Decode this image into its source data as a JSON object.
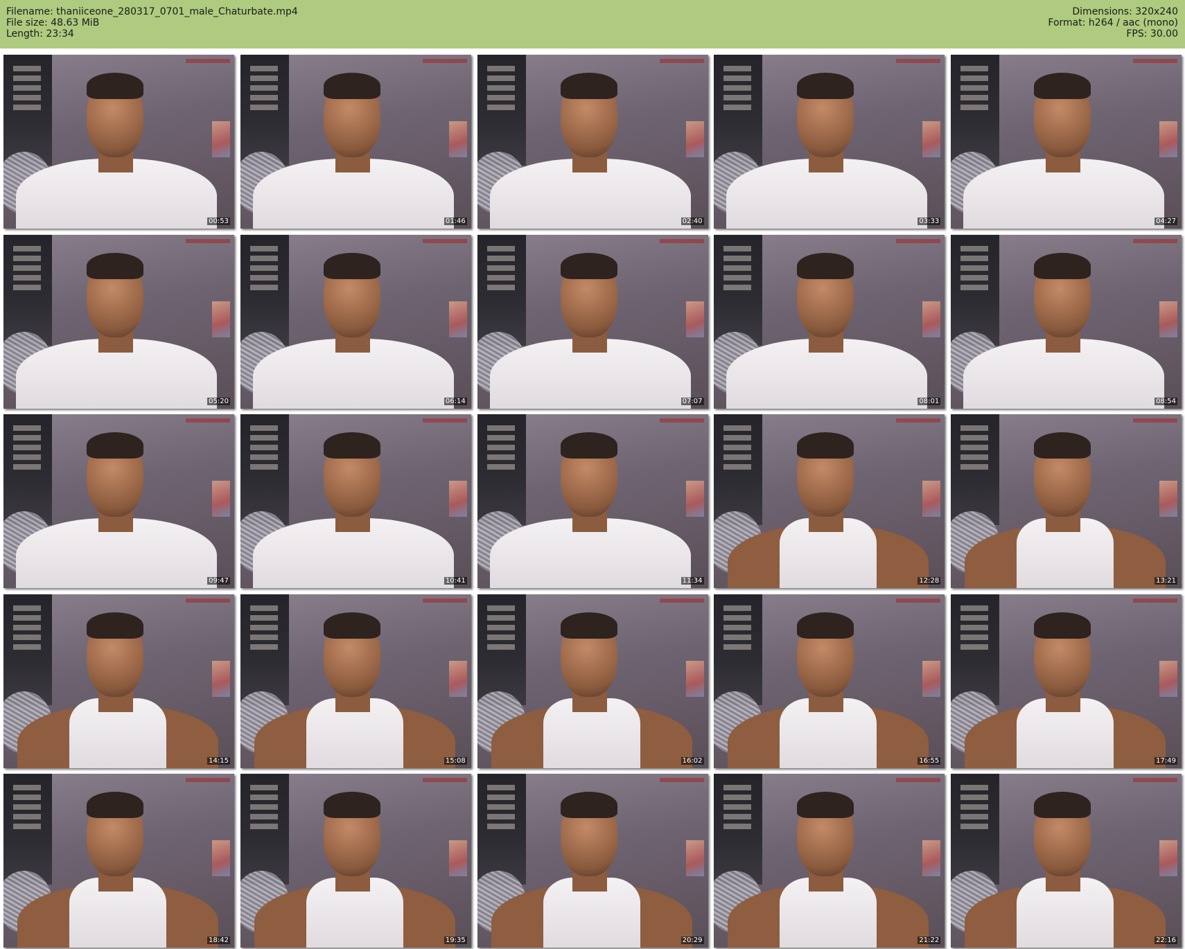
{
  "header": {
    "left": [
      "Filename: thaniiceone_280317_0701_male_Chaturbate.mp4",
      "File size: 48.63 MiB",
      "Length: 23:34"
    ],
    "right": [
      "Dimensions: 320x240",
      "Format: h264 / aac (mono)",
      "FPS: 30.00"
    ]
  },
  "thumbnails": [
    {
      "time": "00:53",
      "shirt": "tee"
    },
    {
      "time": "01:46",
      "shirt": "tee"
    },
    {
      "time": "02:40",
      "shirt": "tee"
    },
    {
      "time": "03:33",
      "shirt": "tee"
    },
    {
      "time": "04:27",
      "shirt": "tee"
    },
    {
      "time": "05:20",
      "shirt": "tee"
    },
    {
      "time": "06:14",
      "shirt": "tee"
    },
    {
      "time": "07:07",
      "shirt": "tee"
    },
    {
      "time": "08:01",
      "shirt": "tee"
    },
    {
      "time": "08:54",
      "shirt": "tee"
    },
    {
      "time": "09:47",
      "shirt": "tee"
    },
    {
      "time": "10:41",
      "shirt": "tee"
    },
    {
      "time": "11:34",
      "shirt": "tee"
    },
    {
      "time": "12:28",
      "shirt": "tank"
    },
    {
      "time": "13:21",
      "shirt": "tank"
    },
    {
      "time": "14:15",
      "shirt": "tank"
    },
    {
      "time": "15:08",
      "shirt": "tank"
    },
    {
      "time": "16:02",
      "shirt": "tank"
    },
    {
      "time": "16:55",
      "shirt": "tank"
    },
    {
      "time": "17:49",
      "shirt": "tank"
    },
    {
      "time": "18:42",
      "shirt": "tank"
    },
    {
      "time": "19:35",
      "shirt": "tank"
    },
    {
      "time": "20:29",
      "shirt": "tank"
    },
    {
      "time": "21:22",
      "shirt": "tank"
    },
    {
      "time": "22:16",
      "shirt": "tank"
    }
  ],
  "colors": {
    "header_bg": "#aecb7f",
    "page_bg": "#ffffff"
  }
}
